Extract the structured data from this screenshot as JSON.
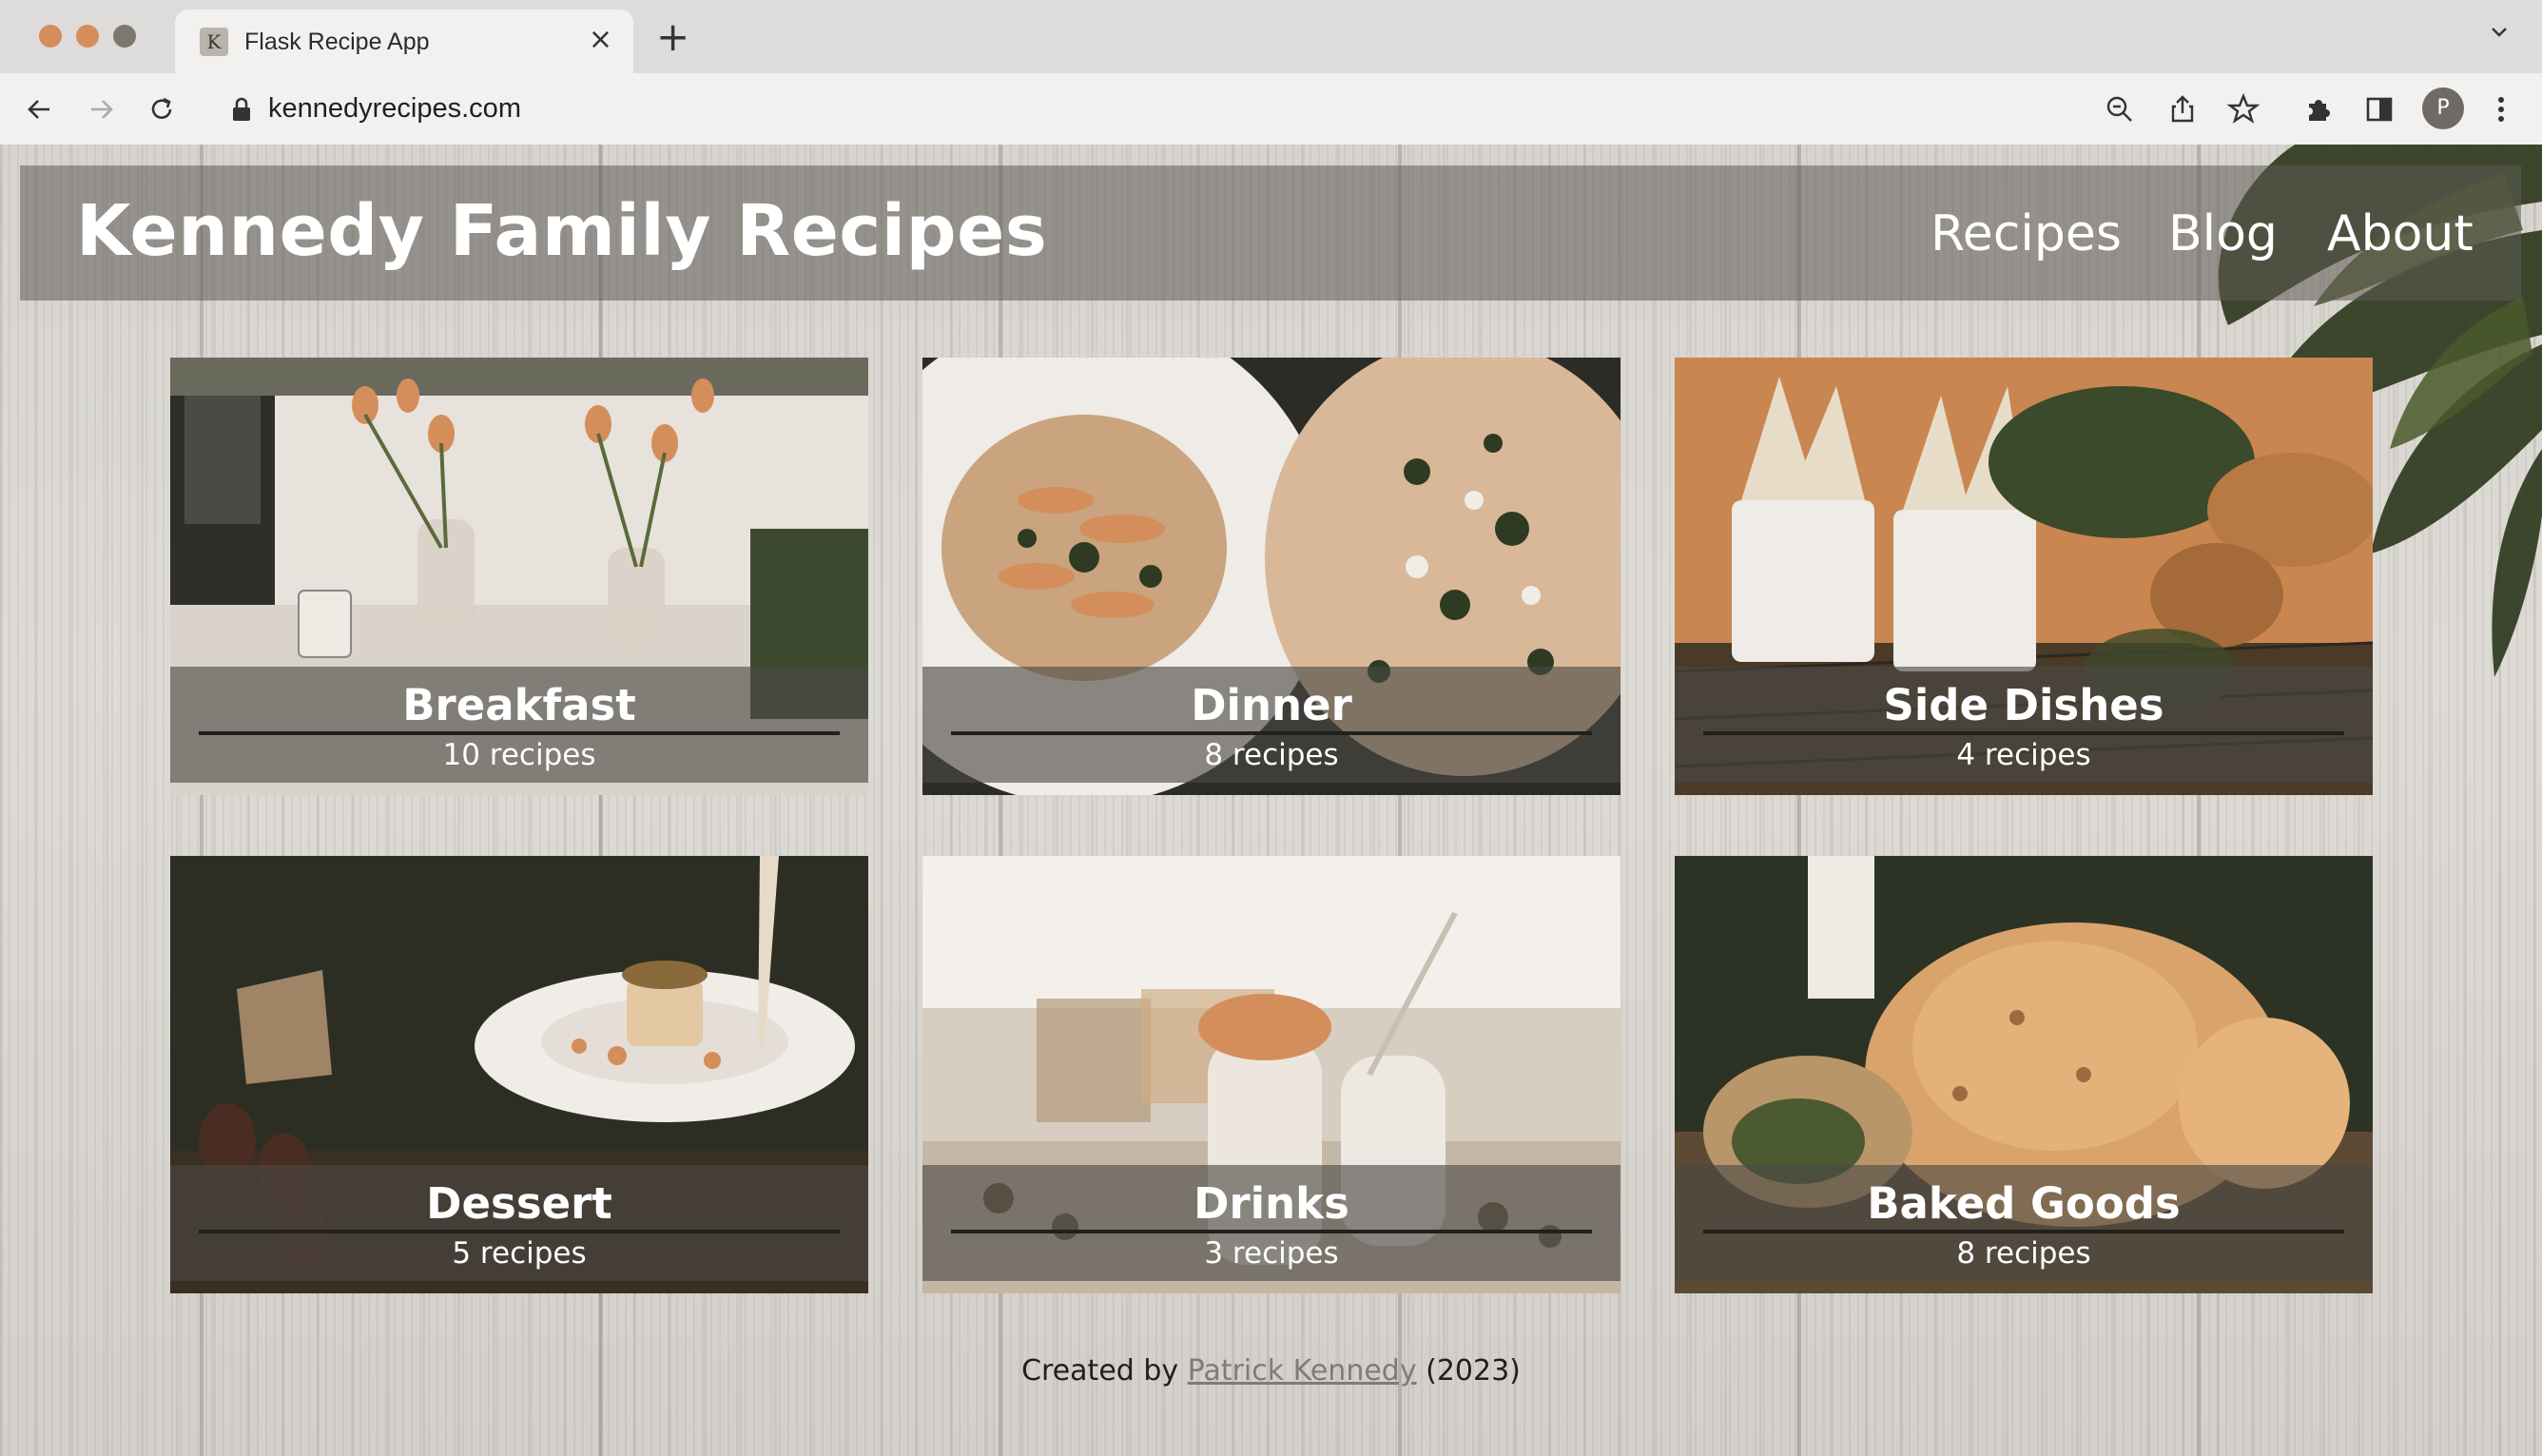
{
  "browser": {
    "tab_title": "Flask Recipe App",
    "favicon_letter": "K",
    "close_glyph": "×",
    "new_tab_glyph": "+",
    "url": "kennedyrecipes.com",
    "profile_initial": "P"
  },
  "site": {
    "title": "Kennedy Family Recipes",
    "nav": [
      "Recipes",
      "Blog",
      "About"
    ]
  },
  "categories": [
    {
      "name": "Breakfast",
      "count": "10 recipes"
    },
    {
      "name": "Dinner",
      "count": "8 recipes"
    },
    {
      "name": "Side Dishes",
      "count": "4 recipes"
    },
    {
      "name": "Dessert",
      "count": "5 recipes"
    },
    {
      "name": "Drinks",
      "count": "3 recipes"
    },
    {
      "name": "Baked Goods",
      "count": "8 recipes"
    }
  ],
  "footer": {
    "prefix": "Created by ",
    "author": "Patrick Kennedy",
    "suffix": " (2023)"
  },
  "icons": [
    "back-arrow-icon",
    "forward-arrow-icon",
    "reload-icon",
    "lock-icon",
    "zoom-icon",
    "share-icon",
    "star-icon",
    "extensions-icon",
    "sidepanel-icon",
    "kebab-menu-icon",
    "chevron-down-icon"
  ],
  "colors": {
    "accent": "#d48e5c",
    "header_band": "#5f5a54"
  }
}
